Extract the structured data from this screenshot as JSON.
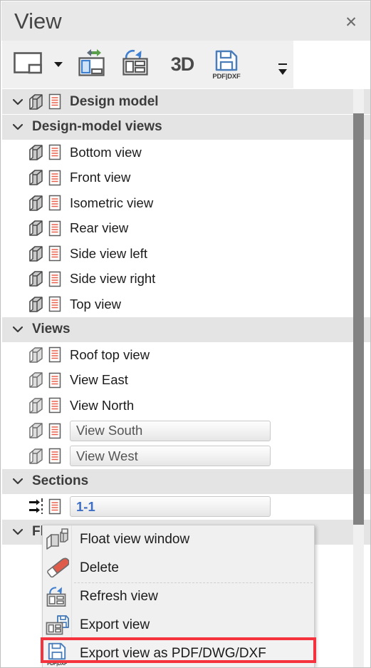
{
  "window": {
    "title": "View",
    "close_label": "✕",
    "close_icon": "close-icon"
  },
  "toolbar": {
    "items": [
      {
        "name": "view-layout-button",
        "icon": "view-layout-icon",
        "label": ""
      },
      {
        "name": "view-layout-dropdown",
        "icon": "chevron-down-icon",
        "label": ""
      },
      {
        "name": "float-view-window-button",
        "icon": "float-view-window-icon",
        "label": ""
      },
      {
        "name": "refresh-view-button",
        "icon": "refresh-view-icon",
        "label": ""
      },
      {
        "name": "three-d-button",
        "icon": "3d-text-icon",
        "label": "3D"
      },
      {
        "name": "export-pdf-dxf-button",
        "icon": "save-pdf-dxf-icon",
        "label": "PDF|DXF"
      }
    ],
    "three_d_label": "3D",
    "pdf_label": "PDF|DXF",
    "overflow_name": "toolbar-overflow-button"
  },
  "tree": {
    "rows": [
      {
        "type": "group",
        "label": "Design model",
        "level": 0,
        "expanded": true,
        "icons": [
          "model-box-icon",
          "document-icon"
        ]
      },
      {
        "type": "group",
        "label": "Design-model views",
        "level": 0,
        "expanded": true,
        "icons": []
      },
      {
        "type": "leaf",
        "label": "Bottom view",
        "level": 1,
        "icons": [
          "model-box-icon",
          "document-icon"
        ],
        "selected": false
      },
      {
        "type": "leaf",
        "label": "Front view",
        "level": 1,
        "icons": [
          "model-box-icon",
          "document-icon"
        ],
        "selected": false
      },
      {
        "type": "leaf",
        "label": "Isometric view",
        "level": 1,
        "icons": [
          "model-box-icon",
          "document-icon"
        ],
        "selected": false
      },
      {
        "type": "leaf",
        "label": "Rear view",
        "level": 1,
        "icons": [
          "model-box-icon",
          "document-icon"
        ],
        "selected": false
      },
      {
        "type": "leaf",
        "label": "Side view left",
        "level": 1,
        "icons": [
          "model-box-icon",
          "document-icon"
        ],
        "selected": false
      },
      {
        "type": "leaf",
        "label": "Side view right",
        "level": 1,
        "icons": [
          "model-box-icon",
          "document-icon"
        ],
        "selected": false
      },
      {
        "type": "leaf",
        "label": "Top view",
        "level": 1,
        "icons": [
          "model-box-icon",
          "document-icon"
        ],
        "selected": false
      },
      {
        "type": "group",
        "label": "Views",
        "level": 0,
        "expanded": true,
        "icons": []
      },
      {
        "type": "leaf",
        "label": "Roof top view",
        "level": 1,
        "icons": [
          "view-box-icon",
          "document-icon"
        ],
        "selected": false
      },
      {
        "type": "leaf",
        "label": "View East",
        "level": 1,
        "icons": [
          "view-box-icon",
          "document-icon"
        ],
        "selected": false
      },
      {
        "type": "leaf",
        "label": "View North",
        "level": 1,
        "icons": [
          "view-box-icon",
          "document-icon"
        ],
        "selected": false
      },
      {
        "type": "leaf",
        "label": "View South",
        "level": 1,
        "icons": [
          "view-box-icon",
          "document-icon"
        ],
        "selected": true
      },
      {
        "type": "leaf",
        "label": "View West",
        "level": 1,
        "icons": [
          "view-box-icon",
          "document-icon"
        ],
        "selected": true
      },
      {
        "type": "group",
        "label": "Sections",
        "level": 0,
        "expanded": true,
        "icons": []
      },
      {
        "type": "leaf",
        "label": "1-1",
        "level": 1,
        "icons": [
          "section-arrows-icon",
          "document-icon"
        ],
        "selected": true,
        "accent": true
      },
      {
        "type": "group",
        "label": "Fl",
        "level": 0,
        "expanded": true,
        "icons": [],
        "truncated": true
      }
    ]
  },
  "context_menu": {
    "items": [
      {
        "label": "Float view window",
        "icon": "float-view-window-icon",
        "highlighted": false
      },
      {
        "label": "Delete",
        "icon": "eraser-icon",
        "highlighted": false
      },
      {
        "label": "Refresh view",
        "icon": "refresh-view-icon",
        "highlighted": false
      },
      {
        "label": "Export view",
        "icon": "export-view-icon",
        "highlighted": false
      },
      {
        "label": "Export view as PDF/DWG/DXF",
        "icon": "save-pdf-dxf-icon",
        "highlighted": true
      }
    ],
    "pdf_mini_label": "PDF|DXF"
  },
  "colors": {
    "accent_blue": "#3f6fc4",
    "icon_blue": "#4a7ebb",
    "doc_red": "#e8604c",
    "highlight_red": "#f5333f",
    "group_bg": "#e4e4e4",
    "titlebar_bg": "#e8e8e8",
    "toolbar_bg": "#f0f0f0",
    "scrollbar_thumb": "#828282",
    "arrow_green": "#5aa04b"
  },
  "scrollbar": {
    "name": "vertical-scrollbar"
  }
}
